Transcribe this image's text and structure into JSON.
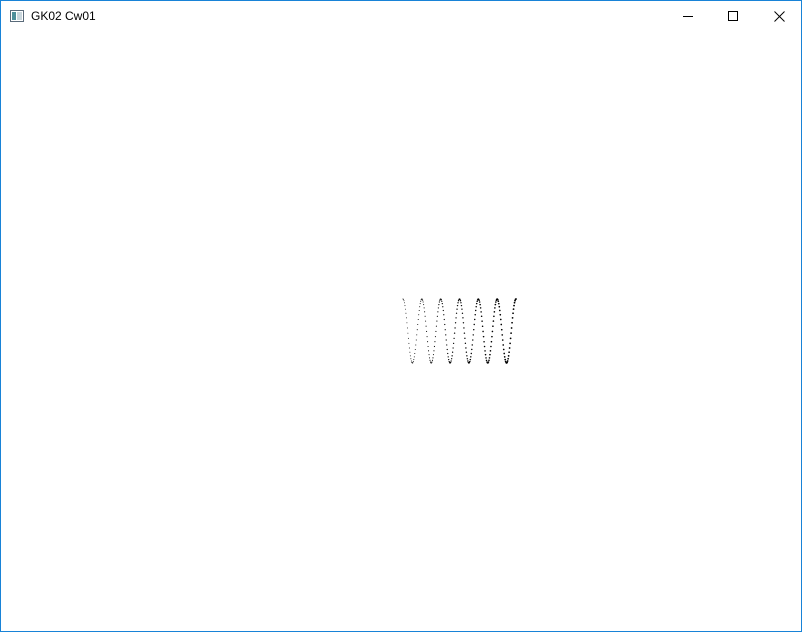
{
  "window": {
    "title": "GK02 Cw01",
    "border_color": "#1883d7",
    "icons": {
      "app": "window-app-icon",
      "minimize": "minimize-icon",
      "maximize": "maximize-icon",
      "close": "close-icon"
    }
  },
  "canvas": {
    "background": "#ffffff",
    "point_color": "#000000",
    "drawing": "dotted-zigzag-curve"
  }
}
